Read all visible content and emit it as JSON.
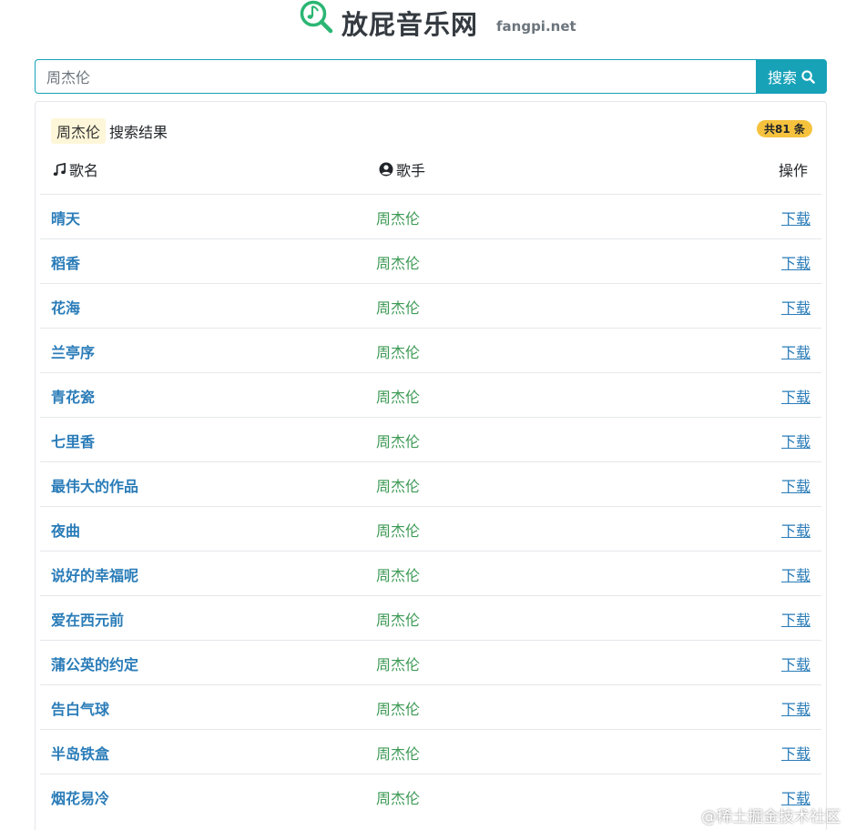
{
  "header": {
    "site_name": "放屁音乐网",
    "site_domain": "fangpi.net"
  },
  "search": {
    "value": "周杰伦",
    "button_label": "搜索"
  },
  "results": {
    "query": "周杰伦",
    "title": "搜索结果",
    "count_label": "共81 条",
    "columns": {
      "song": "歌名",
      "artist": "歌手",
      "action": "操作"
    },
    "rows": [
      {
        "song": "晴天",
        "artist": "周杰伦",
        "action": "下载"
      },
      {
        "song": "稻香",
        "artist": "周杰伦",
        "action": "下载"
      },
      {
        "song": "花海",
        "artist": "周杰伦",
        "action": "下载"
      },
      {
        "song": "兰亭序",
        "artist": "周杰伦",
        "action": "下载"
      },
      {
        "song": "青花瓷",
        "artist": "周杰伦",
        "action": "下载"
      },
      {
        "song": "七里香",
        "artist": "周杰伦",
        "action": "下载"
      },
      {
        "song": "最伟大的作品",
        "artist": "周杰伦",
        "action": "下载"
      },
      {
        "song": "夜曲",
        "artist": "周杰伦",
        "action": "下载"
      },
      {
        "song": "说好的幸福呢",
        "artist": "周杰伦",
        "action": "下载"
      },
      {
        "song": "爱在西元前",
        "artist": "周杰伦",
        "action": "下载"
      },
      {
        "song": "蒲公英的约定",
        "artist": "周杰伦",
        "action": "下载"
      },
      {
        "song": "告白气球",
        "artist": "周杰伦",
        "action": "下载"
      },
      {
        "song": "半岛铁盒",
        "artist": "周杰伦",
        "action": "下载"
      },
      {
        "song": "烟花易冷",
        "artist": "周杰伦",
        "action": "下载"
      }
    ]
  },
  "watermark": "@稀土掘金技术社区",
  "colors": {
    "accent": "#17a2b8",
    "logo": "#2bb673",
    "song_link": "#2a7cb8",
    "artist": "#3d9a55",
    "badge": "#f6c23e"
  },
  "icons": {
    "logo": "music-search-icon",
    "search": "search-icon",
    "song_column": "music-note-icon",
    "artist_column": "user-circle-icon"
  }
}
